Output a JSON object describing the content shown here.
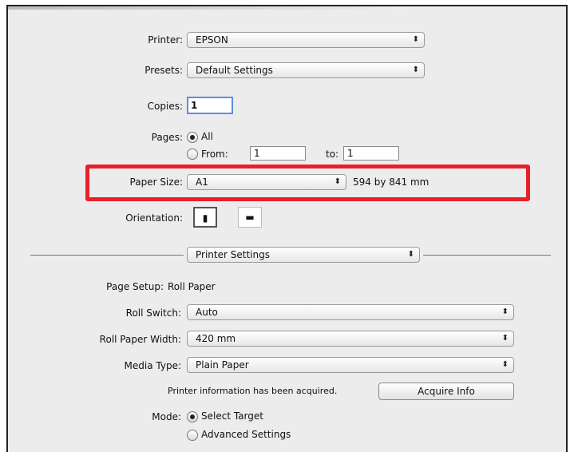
{
  "printer": {
    "label": "Printer:",
    "value": "EPSON"
  },
  "presets": {
    "label": "Presets:",
    "value": "Default Settings"
  },
  "copies": {
    "label": "Copies:",
    "value": "1"
  },
  "pages": {
    "label": "Pages:",
    "all_label": "All",
    "from_label": "From:",
    "from_value": "1",
    "to_label": "to:",
    "to_value": "1"
  },
  "paper_size": {
    "label": "Paper Size:",
    "value": "A1",
    "dimensions": "594 by 841 mm"
  },
  "orientation": {
    "label": "Orientation:",
    "portrait_glyph": "▮",
    "landscape_glyph": "▬"
  },
  "section": {
    "value": "Printer Settings"
  },
  "page_setup": {
    "label": "Page Setup:",
    "value": "Roll Paper"
  },
  "roll_switch": {
    "label": "Roll Switch:",
    "value": "Auto"
  },
  "roll_paper_width": {
    "label": "Roll Paper Width:",
    "value": "420 mm"
  },
  "media_type": {
    "label": "Media Type:",
    "value": "Plain Paper"
  },
  "printer_info": {
    "text": "Printer information has been acquired.",
    "button": "Acquire Info"
  },
  "mode": {
    "label": "Mode:",
    "option1": "Select Target",
    "option2": "Advanced Settings"
  },
  "colors": {
    "highlight": "#e8202a",
    "focus": "#5a8fe0"
  }
}
